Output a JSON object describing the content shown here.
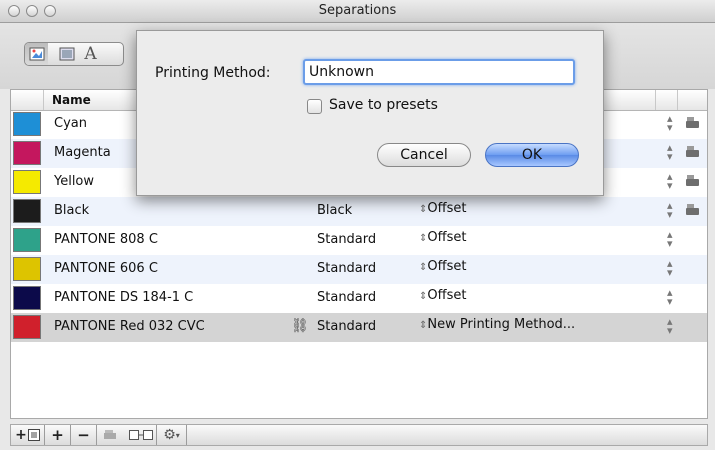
{
  "window": {
    "title": "Separations"
  },
  "table": {
    "header": {
      "name": "Name"
    },
    "rows": [
      {
        "name": "Cyan",
        "type": "",
        "method": "",
        "color": "#1e8fd6",
        "alt": false,
        "selected": false,
        "printer": true,
        "link": false
      },
      {
        "name": "Magenta",
        "type": "",
        "method": "",
        "color": "#c4175e",
        "alt": true,
        "selected": false,
        "printer": true,
        "link": false
      },
      {
        "name": "Yellow",
        "type": "",
        "method": "",
        "color": "#f5ea00",
        "alt": false,
        "selected": false,
        "printer": true,
        "link": false
      },
      {
        "name": "Black",
        "type": "Black",
        "method": "Offset",
        "color": "#1c1c1c",
        "alt": true,
        "selected": false,
        "printer": true,
        "link": false
      },
      {
        "name": "PANTONE 808 C",
        "type": "Standard",
        "method": "Offset",
        "color": "#2ea28a",
        "alt": false,
        "selected": false,
        "printer": false,
        "link": false
      },
      {
        "name": "PANTONE 606 C",
        "type": "Standard",
        "method": "Offset",
        "color": "#ddc400",
        "alt": true,
        "selected": false,
        "printer": false,
        "link": false
      },
      {
        "name": "PANTONE DS 184-1 C",
        "type": "Standard",
        "method": "Offset",
        "color": "#0c0a4a",
        "alt": false,
        "selected": false,
        "printer": false,
        "link": false
      },
      {
        "name": "PANTONE Red 032 CVC",
        "type": "Standard",
        "method": "New Printing Method...",
        "color": "#d0202c",
        "alt": false,
        "selected": true,
        "printer": false,
        "link": true
      }
    ]
  },
  "dialog": {
    "label": "Printing Method:",
    "input_value": "Unknown",
    "checkbox_label": "Save to presets",
    "cancel_label": "Cancel",
    "ok_label": "OK"
  },
  "toolbar": {
    "text_tool_label": "A"
  },
  "bottom_bar": {
    "add_list_icon": "add-list-icon",
    "add_label": "+",
    "remove_label": "−",
    "gear_icon": "gear-icon"
  }
}
